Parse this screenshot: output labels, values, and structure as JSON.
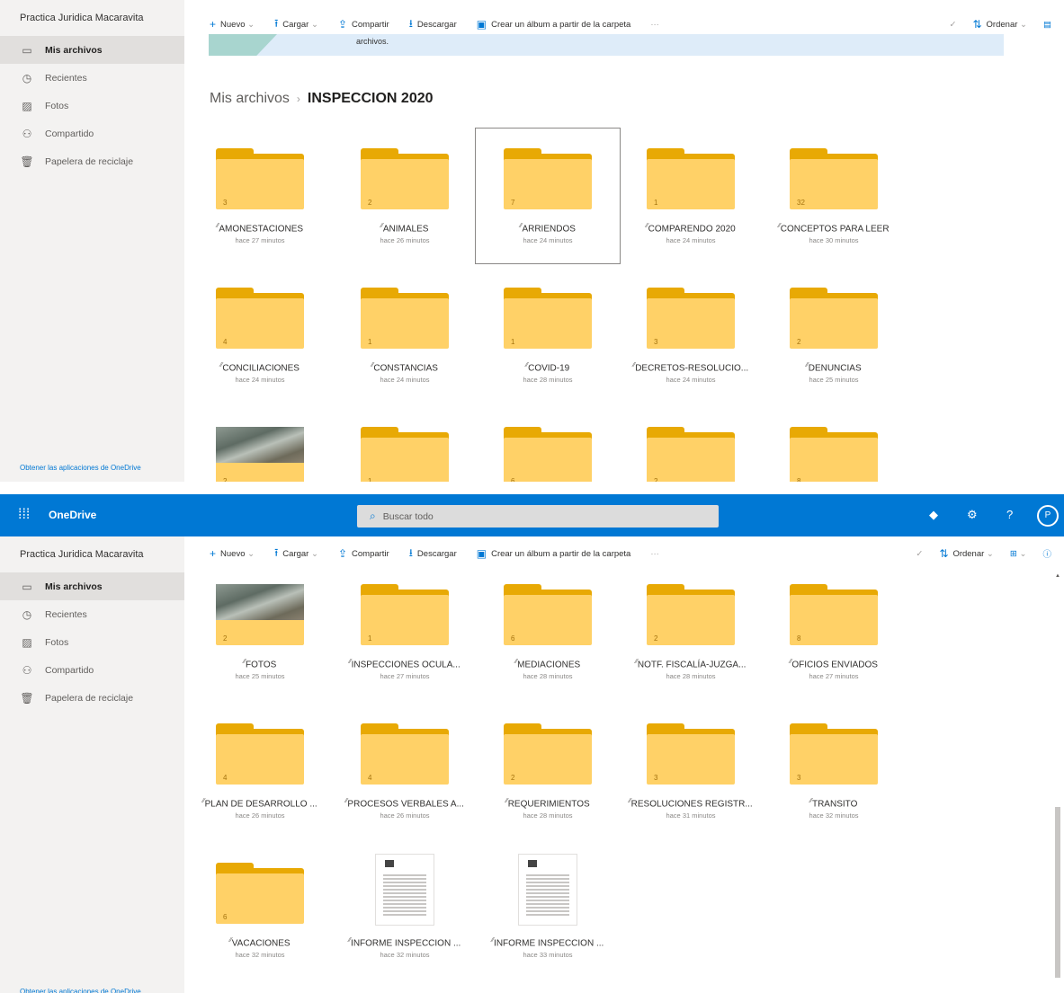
{
  "owner": "Practica Juridica Macaravita",
  "app_name": "OneDrive",
  "search_placeholder": "Buscar todo",
  "avatar_initial": "P",
  "nav": [
    {
      "label": "Mis archivos",
      "icon": "folder-icon",
      "active": true
    },
    {
      "label": "Recientes",
      "icon": "clock-icon"
    },
    {
      "label": "Fotos",
      "icon": "image-icon"
    },
    {
      "label": "Compartido",
      "icon": "people-icon"
    },
    {
      "label": "Papelera de reciclaje",
      "icon": "trash-icon"
    }
  ],
  "get_apps": "Obtener las aplicaciones de OneDrive",
  "commands": {
    "new": "Nuevo",
    "upload": "Cargar",
    "share": "Compartir",
    "download": "Descargar",
    "album": "Crear un álbum a partir de la carpeta",
    "more": "···",
    "sort": "Ordenar"
  },
  "banner_text": "archivos.",
  "breadcrumb": {
    "root": "Mis archivos",
    "current": "INSPECCION 2020"
  },
  "top_items": [
    {
      "name": "AMONESTACIONES",
      "time": "hace 27 minutos",
      "count": "3",
      "type": "folder"
    },
    {
      "name": "ANIMALES",
      "time": "hace 26 minutos",
      "count": "2",
      "type": "folder"
    },
    {
      "name": "ARRIENDOS",
      "time": "hace 24 minutos",
      "count": "7",
      "type": "folder",
      "selected": true
    },
    {
      "name": "COMPARENDO 2020",
      "time": "hace 24 minutos",
      "count": "1",
      "type": "folder"
    },
    {
      "name": "CONCEPTOS PARA LEER",
      "time": "hace 30 minutos",
      "count": "32",
      "type": "folder"
    },
    {
      "name": "CONCILIACIONES",
      "time": "hace 24 minutos",
      "count": "4",
      "type": "folder"
    },
    {
      "name": "CONSTANCIAS",
      "time": "hace 24 minutos",
      "count": "1",
      "type": "folder"
    },
    {
      "name": "COVID-19",
      "time": "hace 28 minutos",
      "count": "1",
      "type": "folder"
    },
    {
      "name": "DECRETOS-RESOLUCIO...",
      "time": "hace 24 minutos",
      "count": "3",
      "type": "folder"
    },
    {
      "name": "DENUNCIAS",
      "time": "hace 25 minutos",
      "count": "2",
      "type": "folder"
    },
    {
      "name": "",
      "time": "",
      "count": "2",
      "type": "photo"
    },
    {
      "name": "",
      "time": "",
      "count": "1",
      "type": "folder"
    },
    {
      "name": "",
      "time": "",
      "count": "6",
      "type": "folder"
    },
    {
      "name": "",
      "time": "",
      "count": "2",
      "type": "folder"
    },
    {
      "name": "",
      "time": "",
      "count": "8",
      "type": "folder"
    }
  ],
  "bottom_items": [
    {
      "name": "FOTOS",
      "time": "hace 25 minutos",
      "count": "2",
      "type": "photo"
    },
    {
      "name": "INSPECCIONES OCULA...",
      "time": "hace 27 minutos",
      "count": "1",
      "type": "folder"
    },
    {
      "name": "MEDIACIONES",
      "time": "hace 28 minutos",
      "count": "6",
      "type": "folder"
    },
    {
      "name": "NOTF. FISCALÍA-JUZGA...",
      "time": "hace 28 minutos",
      "count": "2",
      "type": "folder"
    },
    {
      "name": "OFICIOS ENVIADOS",
      "time": "hace 27 minutos",
      "count": "8",
      "type": "folder"
    },
    {
      "name": "PLAN DE DESARROLLO ...",
      "time": "hace 26 minutos",
      "count": "4",
      "type": "folder"
    },
    {
      "name": "PROCESOS VERBALES A...",
      "time": "hace 26 minutos",
      "count": "4",
      "type": "folder"
    },
    {
      "name": "REQUERIMIENTOS",
      "time": "hace 28 minutos",
      "count": "2",
      "type": "folder"
    },
    {
      "name": "RESOLUCIONES REGISTR...",
      "time": "hace 31 minutos",
      "count": "3",
      "type": "folder"
    },
    {
      "name": "TRANSITO",
      "time": "hace 32 minutos",
      "count": "3",
      "type": "folder"
    },
    {
      "name": "VACACIONES",
      "time": "hace 32 minutos",
      "count": "6",
      "type": "folder"
    },
    {
      "name": "INFORME INSPECCION ...",
      "time": "hace 32 minutos",
      "count": "",
      "type": "doc"
    },
    {
      "name": "INFORME INSPECCION ...",
      "time": "hace 33 minutos",
      "count": "",
      "type": "doc"
    }
  ],
  "colors": {
    "brand": "#0078d4",
    "folder_front": "#ffd167",
    "folder_back": "#e8a904",
    "sidebar": "#f3f2f1"
  }
}
